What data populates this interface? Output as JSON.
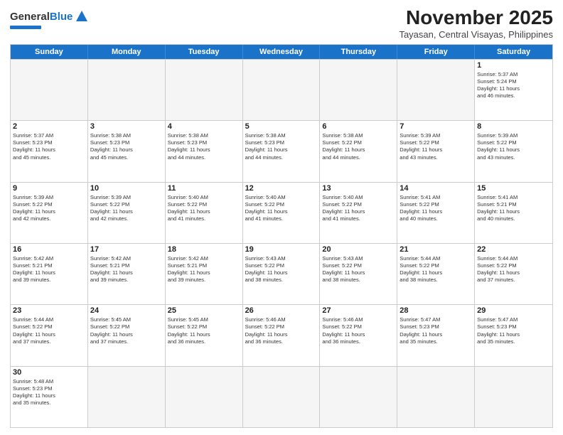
{
  "header": {
    "logo_general": "General",
    "logo_blue": "Blue",
    "title": "November 2025",
    "subtitle": "Tayasan, Central Visayas, Philippines"
  },
  "days_of_week": [
    "Sunday",
    "Monday",
    "Tuesday",
    "Wednesday",
    "Thursday",
    "Friday",
    "Saturday"
  ],
  "weeks": [
    [
      {
        "day": "",
        "text": "",
        "empty": true
      },
      {
        "day": "",
        "text": "",
        "empty": true
      },
      {
        "day": "",
        "text": "",
        "empty": true
      },
      {
        "day": "",
        "text": "",
        "empty": true
      },
      {
        "day": "",
        "text": "",
        "empty": true
      },
      {
        "day": "",
        "text": "",
        "empty": true
      },
      {
        "day": "1",
        "text": "Sunrise: 5:37 AM\nSunset: 5:24 PM\nDaylight: 11 hours\nand 46 minutes."
      }
    ],
    [
      {
        "day": "2",
        "text": "Sunrise: 5:37 AM\nSunset: 5:23 PM\nDaylight: 11 hours\nand 45 minutes."
      },
      {
        "day": "3",
        "text": "Sunrise: 5:38 AM\nSunset: 5:23 PM\nDaylight: 11 hours\nand 45 minutes."
      },
      {
        "day": "4",
        "text": "Sunrise: 5:38 AM\nSunset: 5:23 PM\nDaylight: 11 hours\nand 44 minutes."
      },
      {
        "day": "5",
        "text": "Sunrise: 5:38 AM\nSunset: 5:23 PM\nDaylight: 11 hours\nand 44 minutes."
      },
      {
        "day": "6",
        "text": "Sunrise: 5:38 AM\nSunset: 5:22 PM\nDaylight: 11 hours\nand 44 minutes."
      },
      {
        "day": "7",
        "text": "Sunrise: 5:39 AM\nSunset: 5:22 PM\nDaylight: 11 hours\nand 43 minutes."
      },
      {
        "day": "8",
        "text": "Sunrise: 5:39 AM\nSunset: 5:22 PM\nDaylight: 11 hours\nand 43 minutes."
      }
    ],
    [
      {
        "day": "9",
        "text": "Sunrise: 5:39 AM\nSunset: 5:22 PM\nDaylight: 11 hours\nand 42 minutes."
      },
      {
        "day": "10",
        "text": "Sunrise: 5:39 AM\nSunset: 5:22 PM\nDaylight: 11 hours\nand 42 minutes."
      },
      {
        "day": "11",
        "text": "Sunrise: 5:40 AM\nSunset: 5:22 PM\nDaylight: 11 hours\nand 41 minutes."
      },
      {
        "day": "12",
        "text": "Sunrise: 5:40 AM\nSunset: 5:22 PM\nDaylight: 11 hours\nand 41 minutes."
      },
      {
        "day": "13",
        "text": "Sunrise: 5:40 AM\nSunset: 5:22 PM\nDaylight: 11 hours\nand 41 minutes."
      },
      {
        "day": "14",
        "text": "Sunrise: 5:41 AM\nSunset: 5:22 PM\nDaylight: 11 hours\nand 40 minutes."
      },
      {
        "day": "15",
        "text": "Sunrise: 5:41 AM\nSunset: 5:21 PM\nDaylight: 11 hours\nand 40 minutes."
      }
    ],
    [
      {
        "day": "16",
        "text": "Sunrise: 5:42 AM\nSunset: 5:21 PM\nDaylight: 11 hours\nand 39 minutes."
      },
      {
        "day": "17",
        "text": "Sunrise: 5:42 AM\nSunset: 5:21 PM\nDaylight: 11 hours\nand 39 minutes."
      },
      {
        "day": "18",
        "text": "Sunrise: 5:42 AM\nSunset: 5:21 PM\nDaylight: 11 hours\nand 39 minutes."
      },
      {
        "day": "19",
        "text": "Sunrise: 5:43 AM\nSunset: 5:22 PM\nDaylight: 11 hours\nand 38 minutes."
      },
      {
        "day": "20",
        "text": "Sunrise: 5:43 AM\nSunset: 5:22 PM\nDaylight: 11 hours\nand 38 minutes."
      },
      {
        "day": "21",
        "text": "Sunrise: 5:44 AM\nSunset: 5:22 PM\nDaylight: 11 hours\nand 38 minutes."
      },
      {
        "day": "22",
        "text": "Sunrise: 5:44 AM\nSunset: 5:22 PM\nDaylight: 11 hours\nand 37 minutes."
      }
    ],
    [
      {
        "day": "23",
        "text": "Sunrise: 5:44 AM\nSunset: 5:22 PM\nDaylight: 11 hours\nand 37 minutes."
      },
      {
        "day": "24",
        "text": "Sunrise: 5:45 AM\nSunset: 5:22 PM\nDaylight: 11 hours\nand 37 minutes."
      },
      {
        "day": "25",
        "text": "Sunrise: 5:45 AM\nSunset: 5:22 PM\nDaylight: 11 hours\nand 36 minutes."
      },
      {
        "day": "26",
        "text": "Sunrise: 5:46 AM\nSunset: 5:22 PM\nDaylight: 11 hours\nand 36 minutes."
      },
      {
        "day": "27",
        "text": "Sunrise: 5:46 AM\nSunset: 5:22 PM\nDaylight: 11 hours\nand 36 minutes."
      },
      {
        "day": "28",
        "text": "Sunrise: 5:47 AM\nSunset: 5:23 PM\nDaylight: 11 hours\nand 35 minutes."
      },
      {
        "day": "29",
        "text": "Sunrise: 5:47 AM\nSunset: 5:23 PM\nDaylight: 11 hours\nand 35 minutes."
      }
    ],
    [
      {
        "day": "30",
        "text": "Sunrise: 5:48 AM\nSunset: 5:23 PM\nDaylight: 11 hours\nand 35 minutes."
      },
      {
        "day": "",
        "text": "",
        "empty": true
      },
      {
        "day": "",
        "text": "",
        "empty": true
      },
      {
        "day": "",
        "text": "",
        "empty": true
      },
      {
        "day": "",
        "text": "",
        "empty": true
      },
      {
        "day": "",
        "text": "",
        "empty": true
      },
      {
        "day": "",
        "text": "",
        "empty": true
      }
    ]
  ]
}
